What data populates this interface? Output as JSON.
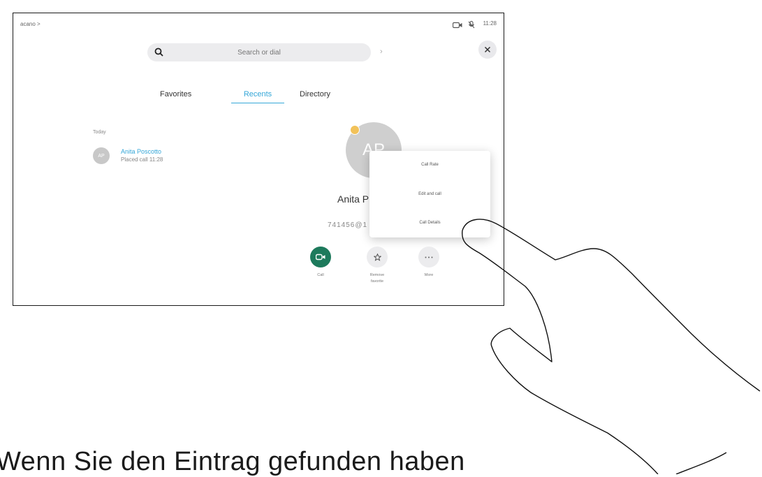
{
  "status": {
    "left_text": "acano >",
    "time": "11:28"
  },
  "search": {
    "placeholder": "Search or dial"
  },
  "tabs": [
    {
      "label": "Favorites"
    },
    {
      "label": "Recents"
    },
    {
      "label": "Directory"
    }
  ],
  "recents": {
    "section": "Today",
    "items": [
      {
        "initials": "AP",
        "name": "Anita Poscotto",
        "detail": "Placed call 11:28"
      }
    ]
  },
  "contact": {
    "initials": "AP",
    "name": "Anita P",
    "number": "741456@1"
  },
  "menu": {
    "items": [
      {
        "label": "Call Rate"
      },
      {
        "label": "Edit and call"
      },
      {
        "label": "Call Details"
      }
    ]
  },
  "actions": [
    {
      "label": "Call",
      "icon": "video-camera-icon"
    },
    {
      "label": "Remove\nfavorite",
      "icon": "star-icon"
    },
    {
      "label": "More",
      "icon": "more-icon"
    }
  ],
  "caption": "Wenn Sie den Eintrag gefunden haben",
  "colors": {
    "accent": "#35a7d8",
    "call_green": "#1d7a5c",
    "favorite": "#f2c25a"
  }
}
